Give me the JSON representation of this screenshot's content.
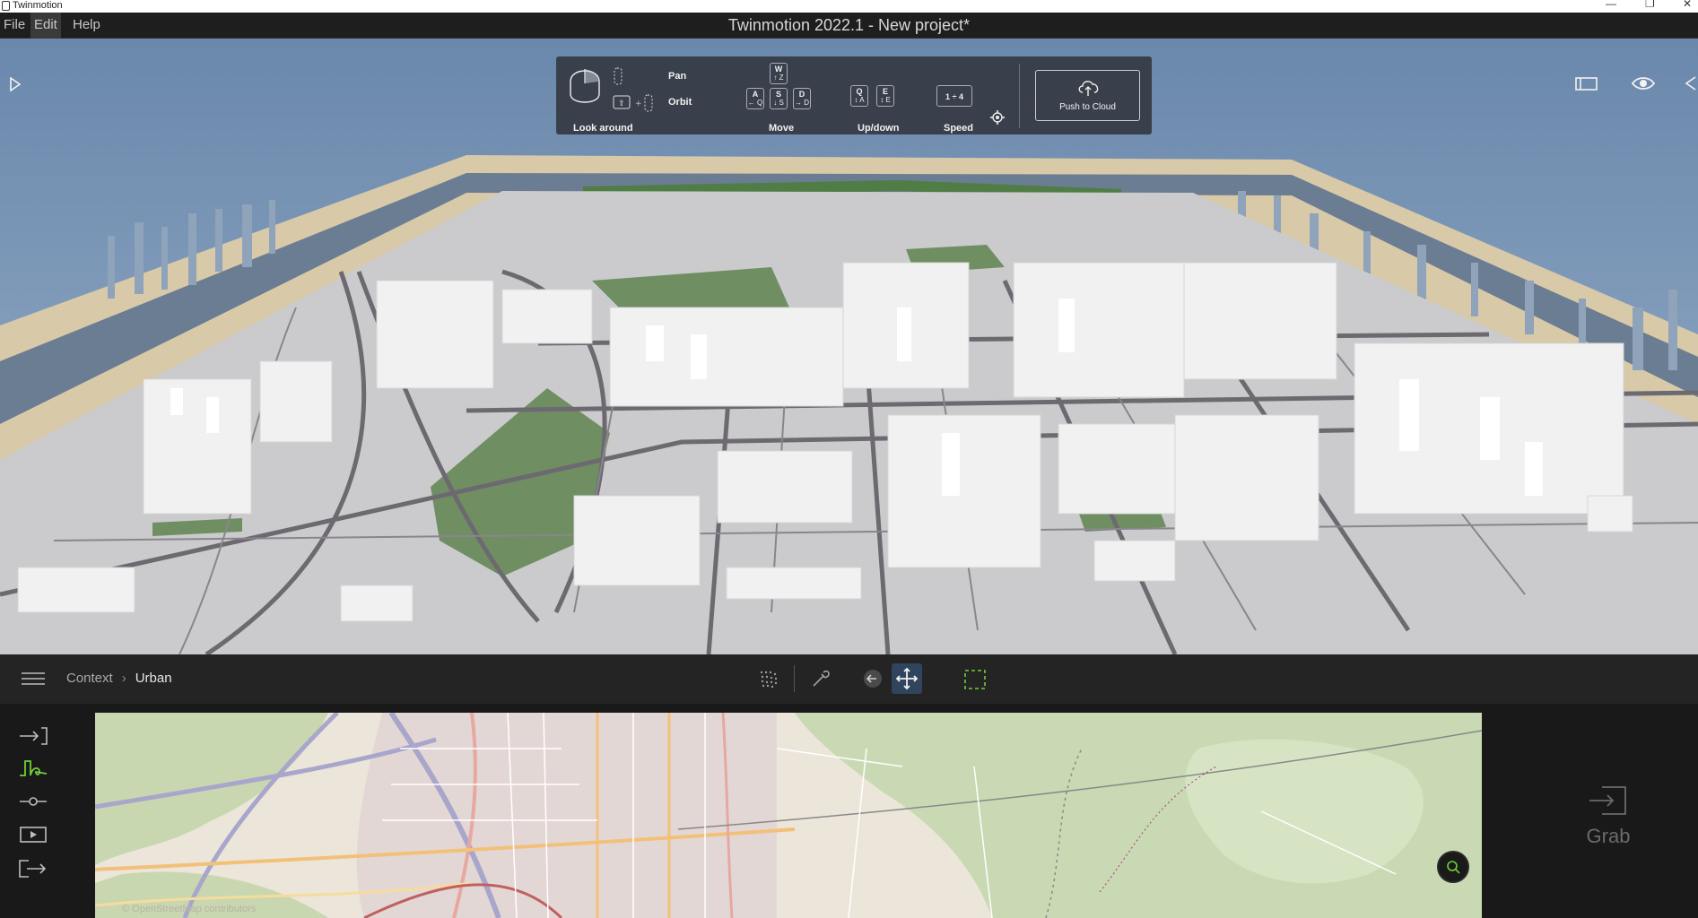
{
  "os": {
    "app_name": "Twinmotion",
    "controls": [
      "—",
      "❐",
      "✕"
    ]
  },
  "menubar": {
    "items": [
      "File",
      "Edit",
      "Help"
    ],
    "active": "Edit",
    "title": "Twinmotion 2022.1 - New project*"
  },
  "nav_panel": {
    "look_around": "Look around",
    "pan": "Pan",
    "orbit": "Orbit",
    "move": "Move",
    "updown": "Up/down",
    "speed": "Speed",
    "speed_keys": "1 ÷ 4",
    "keys": {
      "w": "W",
      "w_sub": "↑ Z",
      "a": "A",
      "a_sub": "← Q",
      "s": "S",
      "s_sub": "↓ S",
      "d": "D",
      "d_sub": "→ D",
      "q": "Q",
      "q_sub": "↕ A",
      "e": "E",
      "e_sub": "↕ E"
    },
    "push_to_cloud": "Push to Cloud"
  },
  "bottom_bar": {
    "breadcrumb_root": "Context",
    "breadcrumb_current": "Urban"
  },
  "map": {
    "attribution": "© OpenStreetMap contributors"
  },
  "grab": {
    "label": "Grab"
  },
  "colors": {
    "accent": "#6fcf3a",
    "active_tool": "#31445e",
    "panel": "#343a42"
  }
}
